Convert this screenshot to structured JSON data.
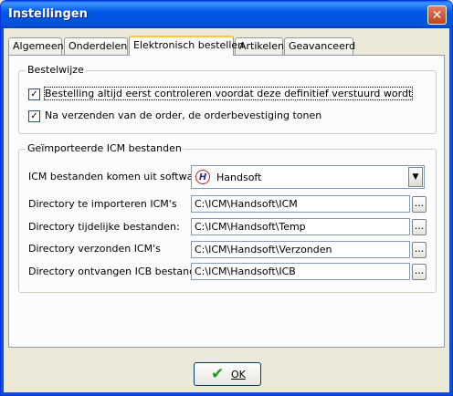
{
  "window": {
    "title": "Instellingen",
    "close_glyph": "✕"
  },
  "tabs": [
    {
      "label": "Algemeen"
    },
    {
      "label": "Onderdelen"
    },
    {
      "label": "Elektronisch bestellen"
    },
    {
      "label": "Artikelen"
    },
    {
      "label": "Geavanceerd"
    }
  ],
  "active_tab": "Elektronisch bestellen",
  "bestelwijze": {
    "title": "Bestelwijze",
    "checks": [
      {
        "label": "Bestelling altijd eerst controleren voordat deze definitief verstuurd wordt",
        "checked": true
      },
      {
        "label": "Na verzenden van de order, de orderbevestiging tonen",
        "checked": true
      }
    ]
  },
  "icm": {
    "title": "Geïmporteerde ICM bestanden",
    "software_label": "ICM bestanden komen uit software:",
    "software_value": "Handsoft",
    "software_logo": "H",
    "fields": [
      {
        "label": "Directory te importeren ICM's",
        "value": "C:\\ICM\\Handsoft\\ICM"
      },
      {
        "label": "Directory tijdelijke bestanden:",
        "value": "C:\\ICM\\Handsoft\\Temp"
      },
      {
        "label": "Directory verzonden ICM's",
        "value": "C:\\ICM\\Handsoft\\Verzonden"
      },
      {
        "label": "Directory ontvangen ICB bestanden:",
        "value": "C:\\ICM\\Handsoft\\ICB"
      }
    ],
    "browse_label": "..."
  },
  "ok_button": {
    "label": "OK",
    "icon": "checkmark-icon"
  },
  "colors": {
    "accent": "#0058e6",
    "ok_check": "#1f9a1f",
    "tab_highlight": "#ffc83c"
  }
}
